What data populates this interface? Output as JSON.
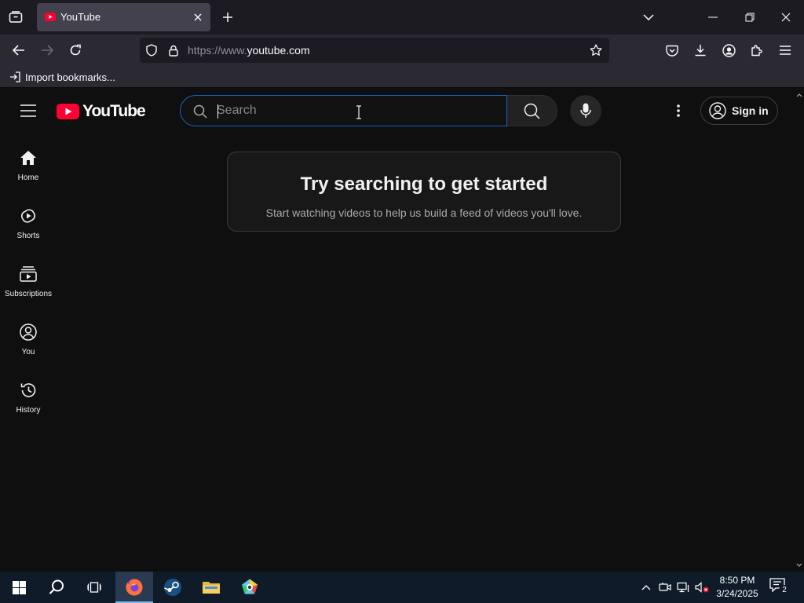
{
  "browser": {
    "tab": {
      "title": "YouTube"
    },
    "url": {
      "prefix": "https://www.",
      "host": "youtube.com"
    },
    "bookmarks": {
      "import_label": "Import bookmarks..."
    }
  },
  "youtube": {
    "logo_text": "YouTube",
    "search": {
      "placeholder": "Search"
    },
    "signin_label": "Sign in",
    "guide": [
      {
        "label": "Home",
        "icon": "home-icon"
      },
      {
        "label": "Shorts",
        "icon": "shorts-icon"
      },
      {
        "label": "Subscriptions",
        "icon": "subscriptions-icon"
      },
      {
        "label": "You",
        "icon": "you-icon"
      },
      {
        "label": "History",
        "icon": "history-icon"
      }
    ],
    "prompt": {
      "title": "Try searching to get started",
      "subtitle": "Start watching videos to help us build a feed of videos you'll love."
    },
    "brand_red": "#ff0033"
  },
  "taskbar": {
    "clock_time": "8:50 PM",
    "clock_date": "3/24/2025",
    "notification_count": "2"
  }
}
